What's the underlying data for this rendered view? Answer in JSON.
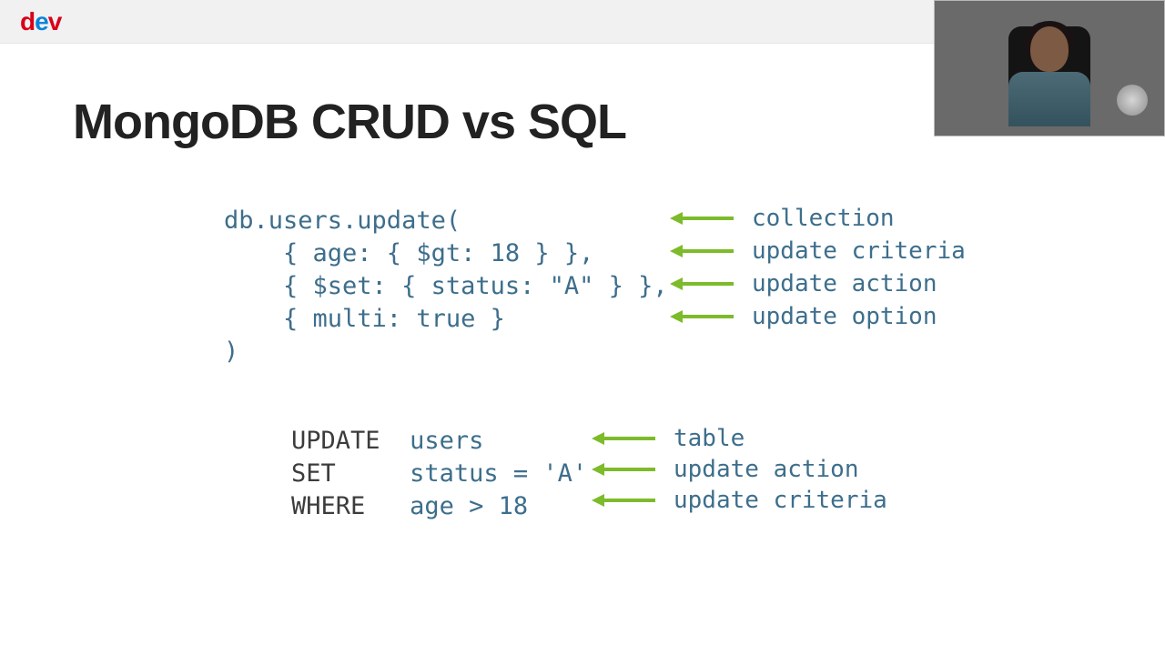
{
  "logo": {
    "d": "d",
    "e": "e",
    "v": "v"
  },
  "title": "MongoDB CRUD vs SQL",
  "mongo": {
    "line1": "db.users.update(",
    "line2": "    { age: { $gt: 18 } },",
    "line3": "    { $set: { status: \"A\" } },",
    "line4": "    { multi: true }",
    "line5": ")",
    "annot1": "collection",
    "annot2": "update criteria",
    "annot3": "update action",
    "annot4": "update option"
  },
  "sql": {
    "kw1": "UPDATE",
    "v1": "users",
    "kw2": "SET",
    "v2": "status = 'A'",
    "kw3": "WHERE",
    "v3": "age > 18",
    "annot1": "table",
    "annot2": "update action",
    "annot3": "update criteria"
  },
  "colors": {
    "arrow": "#7dbb2a",
    "code": "#3d6e8c",
    "keyword": "#3c3c3c"
  }
}
